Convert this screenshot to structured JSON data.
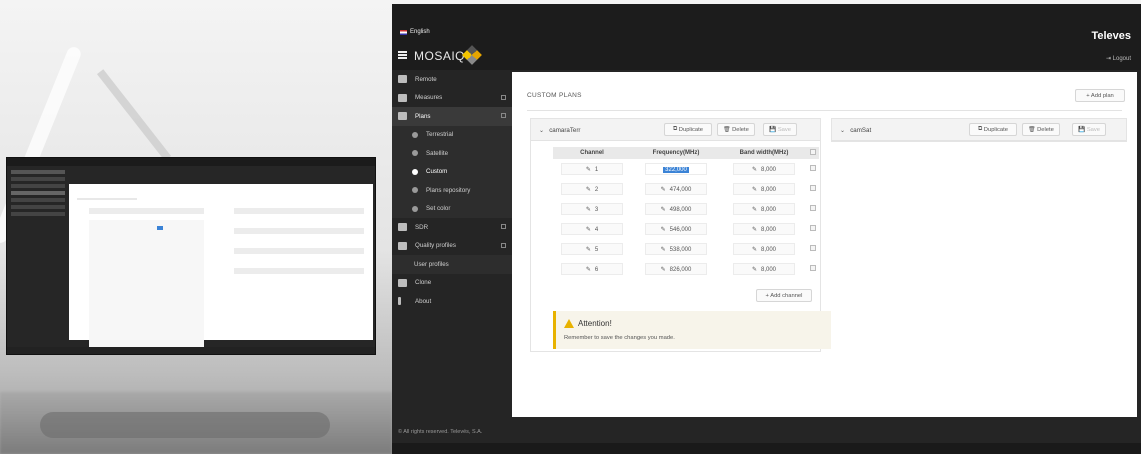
{
  "app": {
    "language": "English",
    "logo_text": "MOSAIQ",
    "brand": "Televes",
    "logout": "Logout",
    "copyright": "© All rights reserved. Televés, S.A."
  },
  "sidebar": {
    "items": [
      {
        "label": "Remote",
        "icon": "remote-icon"
      },
      {
        "label": "Measures",
        "icon": "measures-icon"
      },
      {
        "label": "Plans",
        "icon": "plans-icon",
        "active": true
      },
      {
        "label": "Terrestrial",
        "icon": "terrestrial-icon",
        "sub": true
      },
      {
        "label": "Satellite",
        "icon": "satellite-icon",
        "sub": true
      },
      {
        "label": "Custom",
        "icon": "custom-icon",
        "sub": true,
        "active": true
      },
      {
        "label": "Plans repository",
        "icon": "repository-icon",
        "sub": true
      },
      {
        "label": "Set color",
        "icon": "color-icon",
        "sub": true
      },
      {
        "label": "SDR",
        "icon": "sdr-icon"
      },
      {
        "label": "Quality profiles",
        "icon": "quality-icon"
      },
      {
        "label": "User profiles",
        "icon": "user-icon",
        "sub": true
      },
      {
        "label": "Clone",
        "icon": "clone-icon"
      },
      {
        "label": "About",
        "icon": "about-icon"
      }
    ]
  },
  "main": {
    "title": "CUSTOM PLANS",
    "add_plan": "+ Add plan",
    "panels": [
      {
        "name": "camaraTerr",
        "duplicate": "Duplicate",
        "delete": "Delete",
        "save": "Save",
        "columns": [
          "Channel",
          "Frequency(MHz)",
          "Band width(MHz)"
        ],
        "rows": [
          {
            "channel": "1",
            "frequency": "322,000",
            "bandwidth": "8,000"
          },
          {
            "channel": "2",
            "frequency": "474,000",
            "bandwidth": "8,000"
          },
          {
            "channel": "3",
            "frequency": "498,000",
            "bandwidth": "8,000"
          },
          {
            "channel": "4",
            "frequency": "546,000",
            "bandwidth": "8,000"
          },
          {
            "channel": "5",
            "frequency": "538,000",
            "bandwidth": "8,000"
          },
          {
            "channel": "6",
            "frequency": "826,000",
            "bandwidth": "8,000"
          }
        ],
        "add_channel": "+ Add channel",
        "alert_title": "Attention!",
        "alert_msg": "Remember to save the changes you made."
      },
      {
        "name": "camSat",
        "duplicate": "Duplicate",
        "delete": "Delete",
        "save": "Save"
      }
    ]
  },
  "colors": {
    "accent": "#e8b200",
    "sidebar": "#252525",
    "selection": "#3b83d6"
  }
}
